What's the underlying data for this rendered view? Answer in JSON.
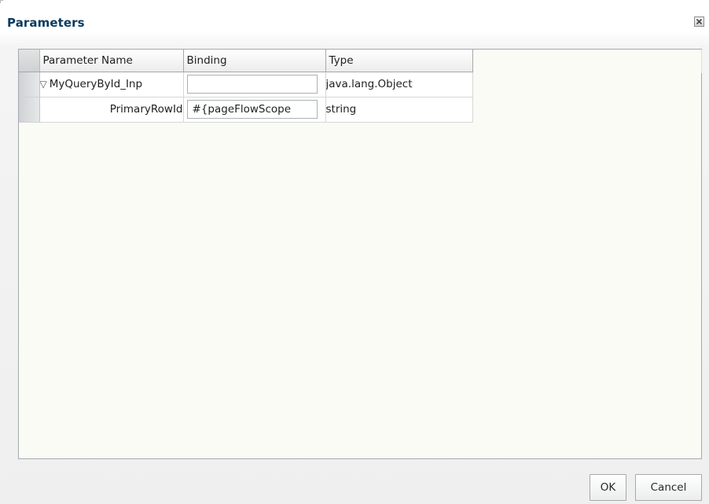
{
  "dialog": {
    "title": "Parameters",
    "close_icon": "close-icon"
  },
  "table": {
    "columns": [
      "Parameter Name",
      "Binding",
      "Type"
    ],
    "rows": [
      {
        "name": "MyQueryById_Inp",
        "expand_icon": "expand-triangle-icon",
        "binding": "",
        "type": "java.lang.Object"
      },
      {
        "name": "PrimaryRowId",
        "binding": "#{pageFlowScope",
        "type": "string"
      }
    ]
  },
  "buttons": {
    "ok": "OK",
    "cancel": "Cancel"
  },
  "colors": {
    "title": "#0b3a5f",
    "panel_background": "#fbfbf6"
  }
}
